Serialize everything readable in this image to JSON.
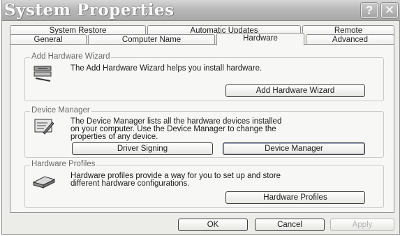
{
  "window": {
    "title": "System Properties"
  },
  "titlebar": {
    "help_glyph": "?",
    "close_glyph": "✕"
  },
  "tabs": {
    "row1": [
      "System Restore",
      "Automatic Updates",
      "Remote"
    ],
    "row2": [
      "General",
      "Computer Name",
      "Hardware",
      "Advanced"
    ],
    "active": "Hardware"
  },
  "add_hardware": {
    "group_label": "Add Hardware Wizard",
    "description": "The Add Hardware Wizard helps you install hardware.",
    "button_label": "Add Hardware Wizard",
    "icon": "hardware-wizard-icon"
  },
  "device_manager": {
    "group_label": "Device Manager",
    "description_lines": [
      "The Device Manager lists all the hardware devices installed",
      "on your computer. Use the Device Manager to change the",
      "properties of any device."
    ],
    "driver_signing_label": "Driver Signing",
    "device_manager_label": "Device Manager",
    "icon": "device-manager-icon"
  },
  "hardware_profiles": {
    "group_label": "Hardware Profiles",
    "description_lines": [
      "Hardware profiles provide a way for you to set up and store",
      "different hardware configurations."
    ],
    "button_label": "Hardware Profiles",
    "icon": "hardware-profiles-icon"
  },
  "footer": {
    "ok_label": "OK",
    "cancel_label": "Cancel",
    "apply_label": "Apply"
  }
}
